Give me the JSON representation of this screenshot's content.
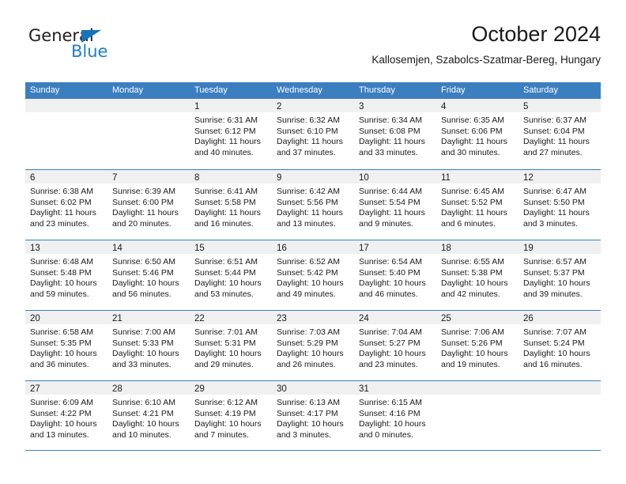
{
  "brand": {
    "name_part1": "General",
    "name_part2": "Blue",
    "triangle_color": "#1573ba",
    "blue_text_color": "#1f7fc4"
  },
  "header": {
    "title": "October 2024",
    "subtitle": "Kallosemjen, Szabolcs-Szatmar-Bereg, Hungary"
  },
  "colors": {
    "header_blue": "#3c7fc0",
    "day_band_gray": "#f0f0f0",
    "text": "#1a1a1a"
  },
  "calendar": {
    "weekday_headers": [
      "Sunday",
      "Monday",
      "Tuesday",
      "Wednesday",
      "Thursday",
      "Friday",
      "Saturday"
    ],
    "weeks": [
      [
        {
          "day": "",
          "sunrise": "",
          "sunset": "",
          "daylight": "",
          "empty": true
        },
        {
          "day": "",
          "sunrise": "",
          "sunset": "",
          "daylight": "",
          "empty": true
        },
        {
          "day": "1",
          "sunrise": "Sunrise: 6:31 AM",
          "sunset": "Sunset: 6:12 PM",
          "daylight": "Daylight: 11 hours and 40 minutes."
        },
        {
          "day": "2",
          "sunrise": "Sunrise: 6:32 AM",
          "sunset": "Sunset: 6:10 PM",
          "daylight": "Daylight: 11 hours and 37 minutes."
        },
        {
          "day": "3",
          "sunrise": "Sunrise: 6:34 AM",
          "sunset": "Sunset: 6:08 PM",
          "daylight": "Daylight: 11 hours and 33 minutes."
        },
        {
          "day": "4",
          "sunrise": "Sunrise: 6:35 AM",
          "sunset": "Sunset: 6:06 PM",
          "daylight": "Daylight: 11 hours and 30 minutes."
        },
        {
          "day": "5",
          "sunrise": "Sunrise: 6:37 AM",
          "sunset": "Sunset: 6:04 PM",
          "daylight": "Daylight: 11 hours and 27 minutes."
        }
      ],
      [
        {
          "day": "6",
          "sunrise": "Sunrise: 6:38 AM",
          "sunset": "Sunset: 6:02 PM",
          "daylight": "Daylight: 11 hours and 23 minutes."
        },
        {
          "day": "7",
          "sunrise": "Sunrise: 6:39 AM",
          "sunset": "Sunset: 6:00 PM",
          "daylight": "Daylight: 11 hours and 20 minutes."
        },
        {
          "day": "8",
          "sunrise": "Sunrise: 6:41 AM",
          "sunset": "Sunset: 5:58 PM",
          "daylight": "Daylight: 11 hours and 16 minutes."
        },
        {
          "day": "9",
          "sunrise": "Sunrise: 6:42 AM",
          "sunset": "Sunset: 5:56 PM",
          "daylight": "Daylight: 11 hours and 13 minutes."
        },
        {
          "day": "10",
          "sunrise": "Sunrise: 6:44 AM",
          "sunset": "Sunset: 5:54 PM",
          "daylight": "Daylight: 11 hours and 9 minutes."
        },
        {
          "day": "11",
          "sunrise": "Sunrise: 6:45 AM",
          "sunset": "Sunset: 5:52 PM",
          "daylight": "Daylight: 11 hours and 6 minutes."
        },
        {
          "day": "12",
          "sunrise": "Sunrise: 6:47 AM",
          "sunset": "Sunset: 5:50 PM",
          "daylight": "Daylight: 11 hours and 3 minutes."
        }
      ],
      [
        {
          "day": "13",
          "sunrise": "Sunrise: 6:48 AM",
          "sunset": "Sunset: 5:48 PM",
          "daylight": "Daylight: 10 hours and 59 minutes."
        },
        {
          "day": "14",
          "sunrise": "Sunrise: 6:50 AM",
          "sunset": "Sunset: 5:46 PM",
          "daylight": "Daylight: 10 hours and 56 minutes."
        },
        {
          "day": "15",
          "sunrise": "Sunrise: 6:51 AM",
          "sunset": "Sunset: 5:44 PM",
          "daylight": "Daylight: 10 hours and 53 minutes."
        },
        {
          "day": "16",
          "sunrise": "Sunrise: 6:52 AM",
          "sunset": "Sunset: 5:42 PM",
          "daylight": "Daylight: 10 hours and 49 minutes."
        },
        {
          "day": "17",
          "sunrise": "Sunrise: 6:54 AM",
          "sunset": "Sunset: 5:40 PM",
          "daylight": "Daylight: 10 hours and 46 minutes."
        },
        {
          "day": "18",
          "sunrise": "Sunrise: 6:55 AM",
          "sunset": "Sunset: 5:38 PM",
          "daylight": "Daylight: 10 hours and 42 minutes."
        },
        {
          "day": "19",
          "sunrise": "Sunrise: 6:57 AM",
          "sunset": "Sunset: 5:37 PM",
          "daylight": "Daylight: 10 hours and 39 minutes."
        }
      ],
      [
        {
          "day": "20",
          "sunrise": "Sunrise: 6:58 AM",
          "sunset": "Sunset: 5:35 PM",
          "daylight": "Daylight: 10 hours and 36 minutes."
        },
        {
          "day": "21",
          "sunrise": "Sunrise: 7:00 AM",
          "sunset": "Sunset: 5:33 PM",
          "daylight": "Daylight: 10 hours and 33 minutes."
        },
        {
          "day": "22",
          "sunrise": "Sunrise: 7:01 AM",
          "sunset": "Sunset: 5:31 PM",
          "daylight": "Daylight: 10 hours and 29 minutes."
        },
        {
          "day": "23",
          "sunrise": "Sunrise: 7:03 AM",
          "sunset": "Sunset: 5:29 PM",
          "daylight": "Daylight: 10 hours and 26 minutes."
        },
        {
          "day": "24",
          "sunrise": "Sunrise: 7:04 AM",
          "sunset": "Sunset: 5:27 PM",
          "daylight": "Daylight: 10 hours and 23 minutes."
        },
        {
          "day": "25",
          "sunrise": "Sunrise: 7:06 AM",
          "sunset": "Sunset: 5:26 PM",
          "daylight": "Daylight: 10 hours and 19 minutes."
        },
        {
          "day": "26",
          "sunrise": "Sunrise: 7:07 AM",
          "sunset": "Sunset: 5:24 PM",
          "daylight": "Daylight: 10 hours and 16 minutes."
        }
      ],
      [
        {
          "day": "27",
          "sunrise": "Sunrise: 6:09 AM",
          "sunset": "Sunset: 4:22 PM",
          "daylight": "Daylight: 10 hours and 13 minutes."
        },
        {
          "day": "28",
          "sunrise": "Sunrise: 6:10 AM",
          "sunset": "Sunset: 4:21 PM",
          "daylight": "Daylight: 10 hours and 10 minutes."
        },
        {
          "day": "29",
          "sunrise": "Sunrise: 6:12 AM",
          "sunset": "Sunset: 4:19 PM",
          "daylight": "Daylight: 10 hours and 7 minutes."
        },
        {
          "day": "30",
          "sunrise": "Sunrise: 6:13 AM",
          "sunset": "Sunset: 4:17 PM",
          "daylight": "Daylight: 10 hours and 3 minutes."
        },
        {
          "day": "31",
          "sunrise": "Sunrise: 6:15 AM",
          "sunset": "Sunset: 4:16 PM",
          "daylight": "Daylight: 10 hours and 0 minutes."
        },
        {
          "day": "",
          "sunrise": "",
          "sunset": "",
          "daylight": "",
          "empty": true
        },
        {
          "day": "",
          "sunrise": "",
          "sunset": "",
          "daylight": "",
          "empty": true
        }
      ]
    ]
  }
}
